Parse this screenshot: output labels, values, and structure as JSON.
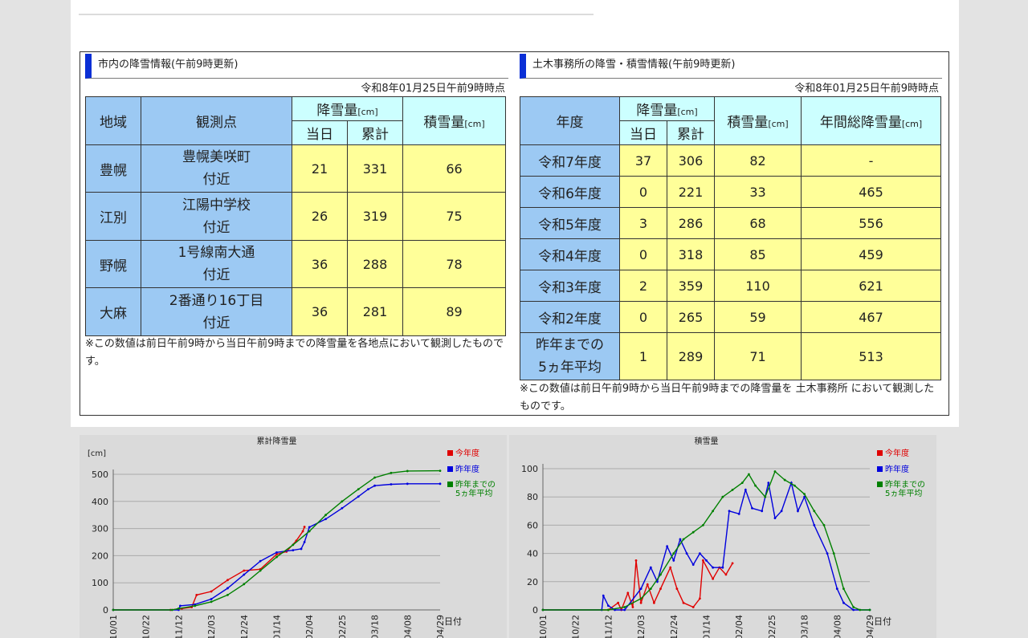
{
  "city": {
    "title": "市内の降雪情報(午前9時更新)",
    "timestamp": "令和8年01月25日午前9時時点",
    "headers": {
      "area": "地域",
      "point": "観測点",
      "snowfall": "降雪量",
      "unit": "[cm]",
      "today": "当日",
      "total": "累計",
      "depth": "積雪量"
    },
    "rows": [
      {
        "area": "豊幌",
        "point1": "豊幌美咲町",
        "point2": "付近",
        "today": "21",
        "total": "331",
        "depth": "66"
      },
      {
        "area": "江別",
        "point1": "江陽中学校",
        "point2": "付近",
        "today": "26",
        "total": "319",
        "depth": "75"
      },
      {
        "area": "野幌",
        "point1": "1号線南大通",
        "point2": "付近",
        "today": "36",
        "total": "288",
        "depth": "78"
      },
      {
        "area": "大麻",
        "point1": "2番通り16丁目",
        "point2": "付近",
        "today": "36",
        "total": "281",
        "depth": "89"
      }
    ],
    "note": "※この数値は前日午前9時から当日午前9時までの降雪量を各地点において観測したものです。"
  },
  "office": {
    "title": "土木事務所の降雪・積雪情報(午前9時更新)",
    "timestamp": "令和8年01月25日午前9時時点",
    "headers": {
      "year": "年度",
      "snowfall": "降雪量",
      "unit": "[cm]",
      "today": "当日",
      "total": "累計",
      "depth": "積雪量",
      "annual": "年間総降雪量"
    },
    "rows": [
      {
        "year": "令和7年度",
        "today": "37",
        "total": "306",
        "depth": "82",
        "annual": "-"
      },
      {
        "year": "令和6年度",
        "today": "0",
        "total": "221",
        "depth": "33",
        "annual": "465"
      },
      {
        "year": "令和5年度",
        "today": "3",
        "total": "286",
        "depth": "68",
        "annual": "556"
      },
      {
        "year": "令和4年度",
        "today": "0",
        "total": "318",
        "depth": "85",
        "annual": "459"
      },
      {
        "year": "令和3年度",
        "today": "2",
        "total": "359",
        "depth": "110",
        "annual": "621"
      },
      {
        "year": "令和2年度",
        "today": "0",
        "total": "265",
        "depth": "59",
        "annual": "467"
      }
    ],
    "avg": {
      "year1": "昨年までの",
      "year2": "5ヵ年平均",
      "today": "1",
      "total": "289",
      "depth": "71",
      "annual": "513"
    },
    "note": "※この数値は前日午前9時から当日午前9時までの降雪量を 土木事務所 において観測したものです。"
  },
  "colors": {
    "this_year": "#e00000",
    "last_year": "#0000dd",
    "avg5": "#008000",
    "accent": "#0a2fd6"
  },
  "chart_data": [
    {
      "type": "line",
      "title": "累計降雪量",
      "ylabel": "[cm]",
      "xlabel": "日付",
      "ylim": [
        0,
        500
      ],
      "yticks": [
        0,
        100,
        200,
        300,
        400,
        500
      ],
      "categories": [
        "10/01",
        "10/22",
        "11/12",
        "12/03",
        "12/24",
        "01/14",
        "02/04",
        "02/25",
        "03/18",
        "04/08",
        "04/29"
      ],
      "legend": [
        "今年度",
        "昨年度",
        "昨年までの",
        "5ヵ年平均"
      ],
      "series": [
        {
          "name": "今年度",
          "color": "#e00000",
          "points": [
            [
              0,
              0
            ],
            [
              1.75,
              0
            ],
            [
              2.1,
              5
            ],
            [
              2.4,
              10
            ],
            [
              2.55,
              55
            ],
            [
              3,
              68
            ],
            [
              3.5,
              110
            ],
            [
              4,
              145
            ],
            [
              4.5,
              150
            ],
            [
              5,
              205
            ],
            [
              5.3,
              215
            ],
            [
              5.6,
              255
            ],
            [
              5.8,
              290
            ],
            [
              5.85,
              306
            ]
          ]
        },
        {
          "name": "昨年度",
          "color": "#0000dd",
          "points": [
            [
              0,
              0
            ],
            [
              2,
              0
            ],
            [
              2.05,
              15
            ],
            [
              2.5,
              20
            ],
            [
              3,
              40
            ],
            [
              3.5,
              80
            ],
            [
              4,
              130
            ],
            [
              4.5,
              180
            ],
            [
              5,
              212
            ],
            [
              5.5,
              220
            ],
            [
              5.75,
              225
            ],
            [
              5.85,
              250
            ],
            [
              6,
              305
            ],
            [
              6.5,
              335
            ],
            [
              7,
              375
            ],
            [
              7.5,
              418
            ],
            [
              7.8,
              445
            ],
            [
              8,
              458
            ],
            [
              8.5,
              463
            ],
            [
              9,
              465
            ],
            [
              10,
              465
            ]
          ]
        },
        {
          "name": "5ヵ年平均",
          "color": "#008000",
          "points": [
            [
              0,
              0
            ],
            [
              1.8,
              0
            ],
            [
              2,
              5
            ],
            [
              2.5,
              15
            ],
            [
              3,
              30
            ],
            [
              3.5,
              55
            ],
            [
              4,
              95
            ],
            [
              4.5,
              145
            ],
            [
              5,
              195
            ],
            [
              5.5,
              240
            ],
            [
              6,
              290
            ],
            [
              6.5,
              350
            ],
            [
              7,
              400
            ],
            [
              7.5,
              445
            ],
            [
              8,
              488
            ],
            [
              8.5,
              505
            ],
            [
              9,
              512
            ],
            [
              10,
              513
            ]
          ]
        }
      ]
    },
    {
      "type": "line",
      "title": "積雪量",
      "ylabel": "",
      "xlabel": "日付",
      "ylim": [
        0,
        100
      ],
      "yticks": [
        0,
        20,
        40,
        60,
        80,
        100
      ],
      "categories": [
        "10/01",
        "10/22",
        "11/12",
        "12/03",
        "12/24",
        "01/14",
        "02/04",
        "02/25",
        "03/18",
        "04/08",
        "04/29"
      ],
      "legend": [
        "今年度",
        "昨年度",
        "昨年までの",
        "5ヵ年平均"
      ],
      "series": [
        {
          "name": "今年度",
          "color": "#e00000",
          "points": [
            [
              0,
              0
            ],
            [
              2,
              0
            ],
            [
              2.3,
              5
            ],
            [
              2.4,
              0
            ],
            [
              2.6,
              12
            ],
            [
              2.75,
              2
            ],
            [
              2.85,
              35
            ],
            [
              3,
              5
            ],
            [
              3.2,
              18
            ],
            [
              3.4,
              5
            ],
            [
              3.6,
              15
            ],
            [
              3.9,
              30
            ],
            [
              4.1,
              15
            ],
            [
              4.3,
              5
            ],
            [
              4.6,
              2
            ],
            [
              4.8,
              8
            ],
            [
              4.9,
              35
            ],
            [
              5.2,
              22
            ],
            [
              5.4,
              30
            ],
            [
              5.6,
              25
            ],
            [
              5.8,
              33
            ]
          ]
        },
        {
          "name": "昨年度",
          "color": "#0000dd",
          "points": [
            [
              0,
              0
            ],
            [
              1.8,
              0
            ],
            [
              1.85,
              10
            ],
            [
              2,
              3
            ],
            [
              2.2,
              0
            ],
            [
              2.5,
              0
            ],
            [
              3,
              15
            ],
            [
              3.3,
              30
            ],
            [
              3.5,
              20
            ],
            [
              3.8,
              45
            ],
            [
              4,
              35
            ],
            [
              4.2,
              50
            ],
            [
              4.4,
              40
            ],
            [
              4.6,
              32
            ],
            [
              4.8,
              40
            ],
            [
              5,
              35
            ],
            [
              5.2,
              30
            ],
            [
              5.5,
              30
            ],
            [
              5.7,
              70
            ],
            [
              6,
              68
            ],
            [
              6.2,
              85
            ],
            [
              6.4,
              72
            ],
            [
              6.7,
              70
            ],
            [
              6.9,
              90
            ],
            [
              7.1,
              65
            ],
            [
              7.3,
              70
            ],
            [
              7.6,
              90
            ],
            [
              7.8,
              70
            ],
            [
              8,
              80
            ],
            [
              8.3,
              60
            ],
            [
              8.7,
              40
            ],
            [
              9,
              15
            ],
            [
              9.2,
              5
            ],
            [
              9.5,
              0
            ],
            [
              10,
              0
            ]
          ]
        },
        {
          "name": "5ヵ年平均",
          "color": "#008000",
          "points": [
            [
              0,
              0
            ],
            [
              2,
              0
            ],
            [
              2.5,
              2
            ],
            [
              3,
              8
            ],
            [
              3.3,
              15
            ],
            [
              3.6,
              25
            ],
            [
              4,
              40
            ],
            [
              4.3,
              50
            ],
            [
              4.6,
              55
            ],
            [
              4.9,
              60
            ],
            [
              5.2,
              70
            ],
            [
              5.5,
              80
            ],
            [
              5.8,
              85
            ],
            [
              6.1,
              90
            ],
            [
              6.3,
              96
            ],
            [
              6.5,
              88
            ],
            [
              6.8,
              80
            ],
            [
              7.1,
              98
            ],
            [
              7.4,
              92
            ],
            [
              7.7,
              88
            ],
            [
              8,
              82
            ],
            [
              8.3,
              70
            ],
            [
              8.6,
              60
            ],
            [
              8.9,
              40
            ],
            [
              9.2,
              15
            ],
            [
              9.5,
              2
            ],
            [
              9.7,
              0
            ],
            [
              10,
              0
            ]
          ]
        }
      ]
    }
  ]
}
